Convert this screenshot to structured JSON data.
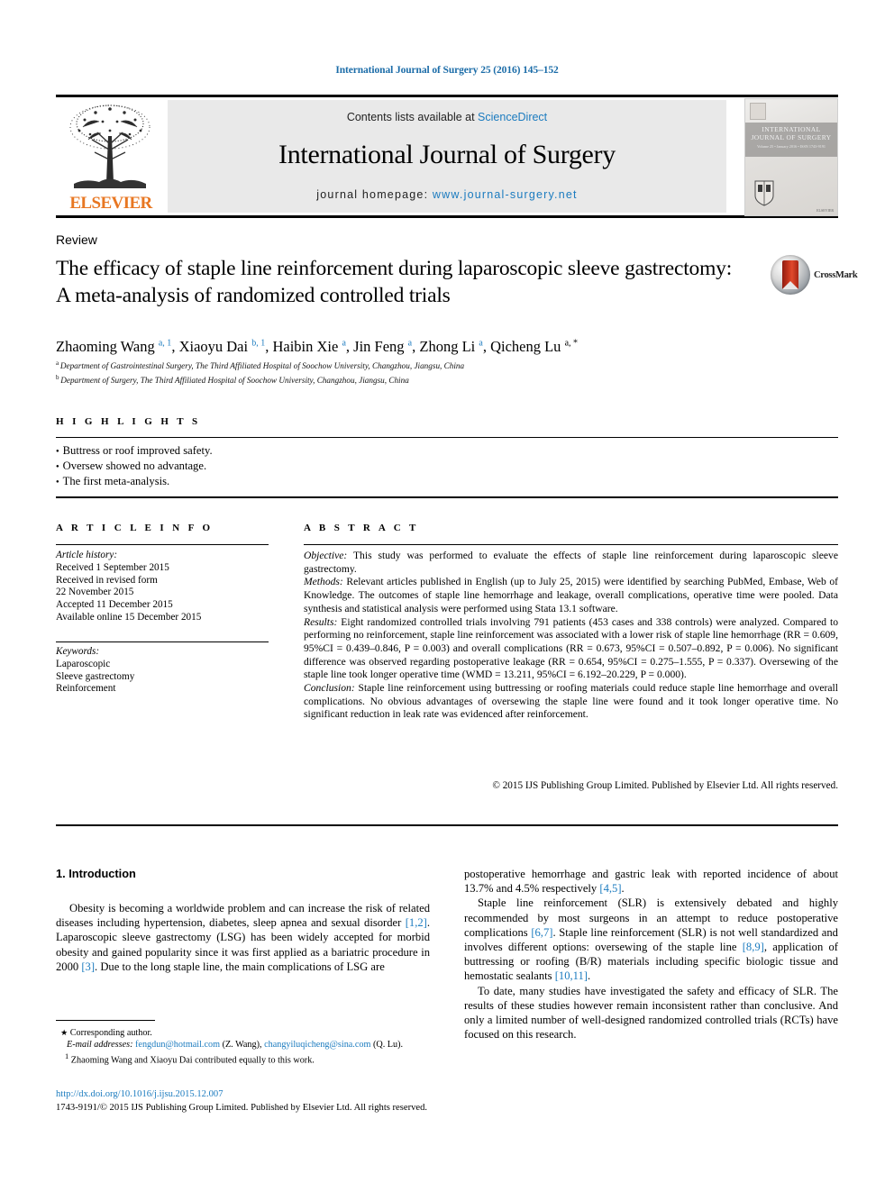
{
  "running_head": "International Journal of Surgery 25 (2016) 145–152",
  "masthead": {
    "publisher_name": "ELSEVIER",
    "contents_prefix": "Contents lists available at ",
    "contents_link": "ScienceDirect",
    "journal_title": "International Journal of Surgery",
    "homepage_prefix": "journal homepage: ",
    "homepage_url": "www.journal-surgery.net",
    "cover": {
      "line1": "INTERNATIONAL",
      "line2": "JOURNAL OF SURGERY",
      "sub": "Volume 25 • January 2016 • ISSN 1743-9191",
      "foot": "ELSEVIER"
    }
  },
  "article": {
    "doctype": "Review",
    "title": "The efficacy of staple line reinforcement during laparoscopic sleeve gastrectomy: A meta-analysis of randomized controlled trials",
    "crossmark_label": "CrossMark",
    "authors": [
      {
        "name": "Zhaoming Wang",
        "marks": "a, 1",
        "sep": ", "
      },
      {
        "name": "Xiaoyu Dai",
        "marks": "b, 1",
        "sep": ", "
      },
      {
        "name": "Haibin Xie",
        "marks": "a",
        "sep": ", "
      },
      {
        "name": "Jin Feng",
        "marks": "a",
        "sep": ", "
      },
      {
        "name": "Zhong Li",
        "marks": "a",
        "sep": ", "
      },
      {
        "name": "Qicheng Lu",
        "marks": "a, *",
        "sep": ""
      }
    ],
    "affiliations": [
      {
        "mark": "a",
        "text": "Department of Gastrointestinal Surgery, The Third Affiliated Hospital of Soochow University, Changzhou, Jiangsu, China"
      },
      {
        "mark": "b",
        "text": "Department of Surgery, The Third Affiliated Hospital of Soochow University, Changzhou, Jiangsu, China"
      }
    ]
  },
  "highlights": {
    "label": "H I G H L I G H T S",
    "items": [
      "Buttress or roof improved safety.",
      "Oversew showed no advantage.",
      "The first meta-analysis."
    ]
  },
  "article_info": {
    "label": "A R T I C L E   I N F O",
    "history_label": "Article history:",
    "history": [
      "Received 1 September 2015",
      "Received in revised form",
      "22 November 2015",
      "Accepted 11 December 2015",
      "Available online 15 December 2015"
    ],
    "keywords_label": "Keywords:",
    "keywords": [
      "Laparoscopic",
      "Sleeve gastrectomy",
      "Reinforcement"
    ]
  },
  "abstract": {
    "label": "A B S T R A C T",
    "sections": [
      {
        "head": "Objective:",
        "body": " This study was performed to evaluate the effects of staple line reinforcement during laparoscopic sleeve gastrectomy."
      },
      {
        "head": "Methods:",
        "body": " Relevant articles published in English (up to July 25, 2015) were identified by searching PubMed, Embase, Web of Knowledge. The outcomes of staple line hemorrhage and leakage, overall complications, operative time were pooled. Data synthesis and statistical analysis were performed using Stata 13.1 software."
      },
      {
        "head": "Results:",
        "body": " Eight randomized controlled trials involving 791 patients (453 cases and 338 controls) were analyzed. Compared to performing no reinforcement, staple line reinforcement was associated with a lower risk of staple line hemorrhage (RR = 0.609, 95%CI = 0.439–0.846, P = 0.003) and overall complications (RR = 0.673, 95%CI = 0.507–0.892, P = 0.006). No significant difference was observed regarding postoperative leakage (RR = 0.654, 95%CI = 0.275–1.555, P = 0.337). Oversewing of the staple line took longer operative time (WMD = 13.211, 95%CI = 6.192–20.229, P = 0.000)."
      },
      {
        "head": "Conclusion:",
        "body": " Staple line reinforcement using buttressing or roofing materials could reduce staple line hemorrhage and overall complications. No obvious advantages of oversewing the staple line were found and it took longer operative time. No significant reduction in leak rate was evidenced after reinforcement."
      }
    ],
    "copyright": "© 2015 IJS Publishing Group Limited. Published by Elsevier Ltd. All rights reserved."
  },
  "body": {
    "section_number_title": "1.  Introduction",
    "left_column": [
      {
        "parts": [
          {
            "t": "text",
            "v": "Obesity is becoming a worldwide problem and can increase the risk of related diseases including hypertension, diabetes, sleep apnea and sexual disorder "
          },
          {
            "t": "ref",
            "v": "[1,2]"
          },
          {
            "t": "text",
            "v": ". Laparoscopic sleeve gastrectomy (LSG) has been widely accepted for morbid obesity and gained popularity since it was first applied as a bariatric procedure in 2000 "
          },
          {
            "t": "ref",
            "v": "[3]"
          },
          {
            "t": "text",
            "v": ". Due to the long staple line, the main complications of LSG are"
          }
        ]
      }
    ],
    "right_column": [
      {
        "parts": [
          {
            "t": "text",
            "v": "postoperative hemorrhage and gastric leak with reported incidence of about 13.7% and 4.5% respectively "
          },
          {
            "t": "ref",
            "v": "[4,5]"
          },
          {
            "t": "text",
            "v": "."
          }
        ],
        "indent": false
      },
      {
        "parts": [
          {
            "t": "text",
            "v": "Staple line reinforcement (SLR) is extensively debated and highly recommended by most surgeons in an attempt to reduce postoperative complications "
          },
          {
            "t": "ref",
            "v": "[6,7]"
          },
          {
            "t": "text",
            "v": ". Staple line reinforcement (SLR) is not well standardized and involves different options: oversewing of the staple line "
          },
          {
            "t": "ref",
            "v": "[8,9]"
          },
          {
            "t": "text",
            "v": ", application of buttressing or roofing (B/R) materials including specific biologic tissue and hemostatic sealants "
          },
          {
            "t": "ref",
            "v": "[10,11]"
          },
          {
            "t": "text",
            "v": "."
          }
        ],
        "indent": true
      },
      {
        "parts": [
          {
            "t": "text",
            "v": "To date, many studies have investigated the safety and efficacy of SLR. The results of these studies however remain inconsistent rather than conclusive. And only a limited number of well-designed randomized controlled trials (RCTs) have focused on this research."
          }
        ],
        "indent": true
      }
    ]
  },
  "footnotes": {
    "corresponding": "Corresponding author.",
    "email_label": "E-mail addresses:",
    "email1": "fengdun@hotmail.com",
    "email1_owner": "(Z. Wang)",
    "email2": "changyiluqicheng@sina.com",
    "email2_owner": "(Q. Lu).",
    "equal_contrib_mark": "1",
    "equal_contrib": "Zhaoming Wang and Xiaoyu Dai contributed equally to this work."
  },
  "footer": {
    "doi": "http://dx.doi.org/10.1016/j.ijsu.2015.12.007",
    "issn_line": "1743-9191/© 2015 IJS Publishing Group Limited. Published by Elsevier Ltd. All rights reserved."
  },
  "colors": {
    "link_blue": "#1b7bbf",
    "running_head_blue": "#1b6ca8",
    "elsevier_orange": "#e87722"
  }
}
